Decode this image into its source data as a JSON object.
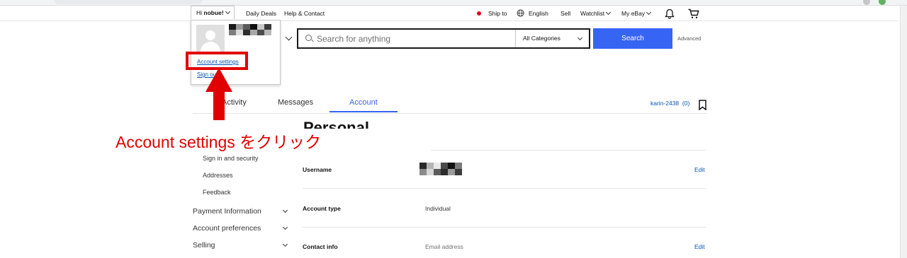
{
  "topnav": {
    "greeting_prefix": "Hi ",
    "greeting_name": "nobue!",
    "daily_deals": "Daily Deals",
    "help_contact": "Help & Contact",
    "ship_to": "Ship to",
    "language": "English",
    "sell": "Sell",
    "watchlist": "Watchlist",
    "my_ebay": "My eBay"
  },
  "search": {
    "placeholder": "Search for anything",
    "category": "All Categories",
    "button": "Search",
    "advanced": "Advanced"
  },
  "account_dropdown": {
    "account_settings": "Account settings",
    "sign_out": "Sign out"
  },
  "annotation": {
    "instruction": "Account settings をクリック",
    "color": "#e00000"
  },
  "tabs": [
    {
      "label": "Activity"
    },
    {
      "label": "Messages"
    },
    {
      "label": "Account",
      "active": true
    }
  ],
  "user": {
    "id": "karin-2438",
    "feedback_count": "(0)"
  },
  "left_menu": {
    "sub_items": [
      "Sign in and security",
      "Addresses",
      "Feedback"
    ],
    "sections": [
      "Payment Information",
      "Account preferences",
      "Selling"
    ]
  },
  "content": {
    "heading": "Personal Info",
    "rows": [
      {
        "label": "Username",
        "value": "",
        "edit": "Edit"
      },
      {
        "label": "Account type",
        "value": "Individual",
        "edit": ""
      },
      {
        "label": "Contact info",
        "value": "Email address",
        "edit": "Edit"
      }
    ]
  },
  "colors": {
    "accent": "#3665f3",
    "link": "#0654ba",
    "annotation": "#e00000"
  }
}
